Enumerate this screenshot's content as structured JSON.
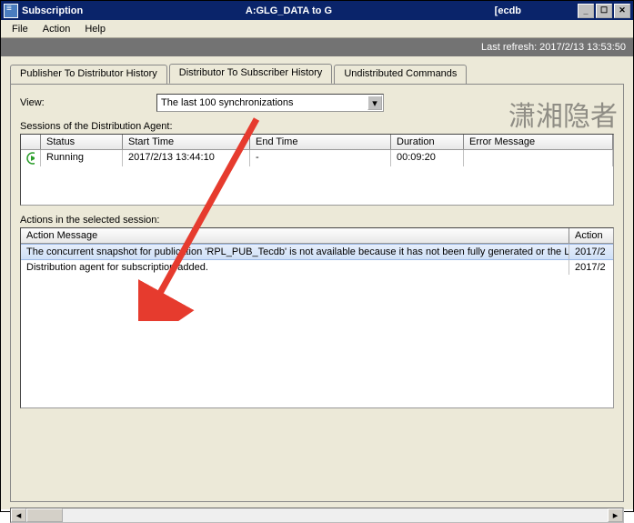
{
  "titlebar": {
    "left": "Subscription",
    "center": "A:GLG_DATA to G",
    "right": "[ecdb"
  },
  "menu": {
    "file": "File",
    "action": "Action",
    "help": "Help"
  },
  "refresh": {
    "label": "Last refresh: 2017/2/13 13:53:50"
  },
  "tabs": {
    "pub": "Publisher To Distributor History",
    "dist": "Distributor To Subscriber History",
    "undist": "Undistributed Commands"
  },
  "view": {
    "label": "View:",
    "value": "The last 100 synchronizations"
  },
  "sessions": {
    "label": "Sessions of the Distribution Agent:",
    "cols": {
      "status": "Status",
      "start": "Start Time",
      "end": "End Time",
      "duration": "Duration",
      "error": "Error Message"
    },
    "row": {
      "status": "Running",
      "start": "2017/2/13 13:44:10",
      "end": "-",
      "duration": "00:09:20",
      "error": ""
    }
  },
  "actions": {
    "label": "Actions in the selected session:",
    "cols": {
      "msg": "Action Message",
      "act": "Action"
    },
    "rows": [
      {
        "msg": "The concurrent snapshot for publication 'RPL_PUB_Tecdb' is not available because it has not been fully generated or the Log…",
        "act": "2017/2"
      },
      {
        "msg": "Distribution agent for subscription added.",
        "act": "2017/2"
      }
    ]
  },
  "watermark": "潇湘隐者"
}
